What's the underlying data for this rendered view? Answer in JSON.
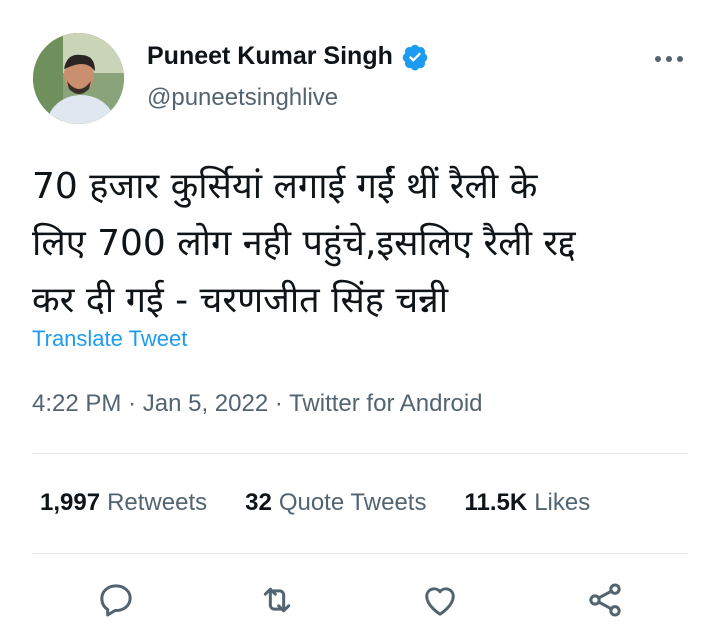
{
  "author": {
    "name": "Puneet Kumar Singh",
    "handle": "@puneetsinghlive",
    "verified": true
  },
  "tweet": {
    "text_lines": [
      "70 हजार कुर्सियां लगाई गईं थीं रैली के",
      "लिए 700 लोग नही पहुंचे,इसलिए रैली रद्द",
      "कर दी गई - चरणजीत सिंह चन्नी"
    ],
    "translate_label": "Translate Tweet",
    "time": "4:22 PM",
    "date": "Jan 5, 2022",
    "source": "Twitter for Android",
    "separator": "·"
  },
  "stats": {
    "retweets_count": "1,997",
    "retweets_label": "Retweets",
    "quotes_count": "32",
    "quotes_label": "Quote Tweets",
    "likes_count": "11.5K",
    "likes_label": "Likes"
  },
  "icons": {
    "more": "more-options-icon",
    "reply": "reply-icon",
    "retweet": "retweet-icon",
    "like": "heart-icon",
    "share": "share-icon",
    "verified": "verified-badge-icon"
  },
  "colors": {
    "accent": "#1d9bf0",
    "text": "#0f1419",
    "secondary": "#536471",
    "divider": "#e7eaec"
  }
}
